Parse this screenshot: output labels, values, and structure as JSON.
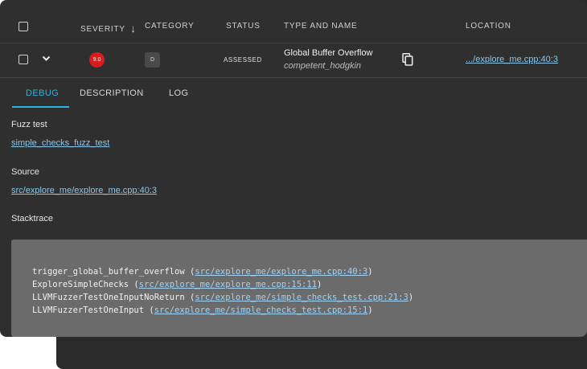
{
  "header": {
    "severity": "SEVERITY",
    "category": "CATEGORY",
    "status": "STATUS",
    "type_and_name": "TYPE AND NAME",
    "location": "LOCATION"
  },
  "row": {
    "severity_value": "9.0",
    "category_value": "D",
    "status": "ASSESSED",
    "type": "Global Buffer Overflow",
    "name": "competent_hodgkin",
    "location": ".../explore_me.cpp:40:3",
    "severity_color": "#d81b1b"
  },
  "tabs": [
    "DEBUG",
    "DESCRIPTION",
    "LOG"
  ],
  "active_tab": "DEBUG",
  "debug": {
    "fuzz_test_label": "Fuzz test",
    "fuzz_test_link": "simple_checks_fuzz_test",
    "source_label": "Source",
    "source_link": "src/explore_me/explore_me.cpp:40:3",
    "stacktrace_label": "Stacktrace",
    "stacktrace": [
      {
        "func": "trigger_global_buffer_overflow",
        "loc": "src/explore_me/explore_me.cpp:40:3"
      },
      {
        "func": "ExploreSimpleChecks",
        "loc": "src/explore_me/explore_me.cpp:15:11"
      },
      {
        "func": "LLVMFuzzerTestOneInputNoReturn",
        "loc": "src/explore_me/simple_checks_test.cpp:21:3"
      },
      {
        "func": "LLVMFuzzerTestOneInput",
        "loc": "src/explore_me/simple_checks_test.cpp:15:1"
      }
    ]
  },
  "accent_color": "#29b6e6",
  "link_color": "#8ec5e8"
}
